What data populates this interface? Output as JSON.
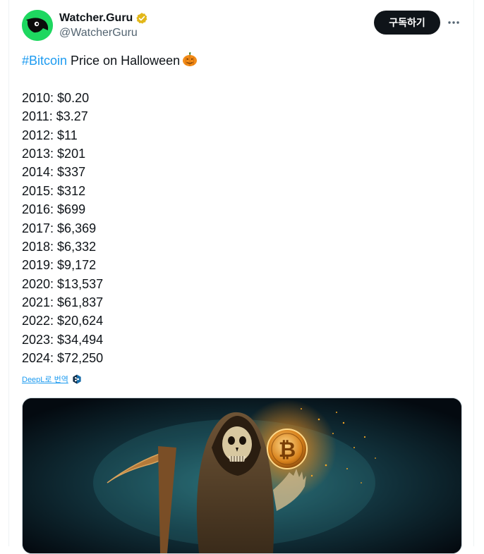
{
  "author": {
    "display_name": "Watcher.Guru",
    "handle": "@WatcherGuru",
    "verified": true
  },
  "actions": {
    "subscribe_label": "구독하기",
    "more_icon": "ellipsis-icon"
  },
  "tweet": {
    "hashtag": "#Bitcoin",
    "headline": " Price on Halloween",
    "emoji": "jack-o-lantern",
    "prices": [
      "2010: $0.20",
      "2011: $3.27",
      "2012: $11",
      "2013: $201",
      "2014: $337",
      "2015: $312",
      "2016: $699",
      "2017: $6,369",
      "2018: $6,332",
      "2019: $9,172",
      "2020: $13,537",
      "2021: $61,837",
      "2022: $20,624",
      "2023: $34,494",
      "2024: $72,250"
    ],
    "translate_label": "DeepL로 번역"
  },
  "colors": {
    "link": "#1d9bf0",
    "verified_badge": "#e2b719",
    "avatar_bg": "#1ed760"
  }
}
